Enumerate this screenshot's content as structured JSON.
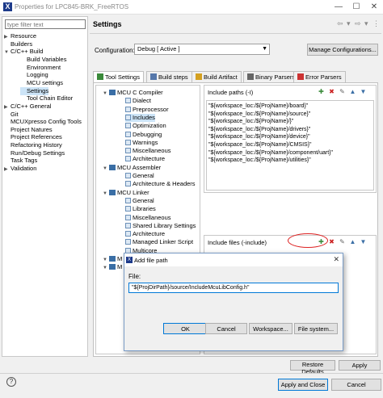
{
  "window": {
    "title": "Properties for LPC845-BRK_FreeRTOS",
    "app_icon_glyph": "X",
    "minimize": "—",
    "maximize": "☐",
    "close": "✕"
  },
  "left": {
    "filter_placeholder": "type filter text",
    "tree": [
      {
        "label": "Resource",
        "arrow": "▶",
        "indent": 0
      },
      {
        "label": "Builders",
        "arrow": "",
        "indent": 0
      },
      {
        "label": "C/C++ Build",
        "arrow": "▼",
        "indent": 0
      },
      {
        "label": "Build Variables",
        "arrow": "",
        "indent": 1
      },
      {
        "label": "Environment",
        "arrow": "",
        "indent": 1
      },
      {
        "label": "Logging",
        "arrow": "",
        "indent": 1
      },
      {
        "label": "MCU settings",
        "arrow": "",
        "indent": 1
      },
      {
        "label": "Settings",
        "arrow": "",
        "indent": 1,
        "selected": true
      },
      {
        "label": "Tool Chain Editor",
        "arrow": "",
        "indent": 1
      },
      {
        "label": "C/C++ General",
        "arrow": "▶",
        "indent": 0
      },
      {
        "label": "Git",
        "arrow": "",
        "indent": 0
      },
      {
        "label": "MCUXpresso Config Tools",
        "arrow": "",
        "indent": 0
      },
      {
        "label": "Project Natures",
        "arrow": "",
        "indent": 0
      },
      {
        "label": "Project References",
        "arrow": "",
        "indent": 0
      },
      {
        "label": "Refactoring History",
        "arrow": "",
        "indent": 0
      },
      {
        "label": "Run/Debug Settings",
        "arrow": "",
        "indent": 0
      },
      {
        "label": "Task Tags",
        "arrow": "",
        "indent": 0
      },
      {
        "label": "Validation",
        "arrow": "▶",
        "indent": 0
      }
    ]
  },
  "header": {
    "title": "Settings",
    "nav": [
      "⇦",
      "▾",
      "⇨",
      "▾",
      "⋮"
    ]
  },
  "config": {
    "label": "Configuration:",
    "value": "Debug  [ Active ]",
    "manage_label": "Manage Configurations..."
  },
  "tabs": [
    {
      "label": "Tool Settings",
      "active": true,
      "color": "#3a8a3a"
    },
    {
      "label": "Build steps",
      "active": false,
      "color": "#5577aa"
    },
    {
      "label": "Build Artifact",
      "active": false,
      "color": "#d4a020"
    },
    {
      "label": "Binary Parsers",
      "active": false,
      "color": "#666666"
    },
    {
      "label": "Error Parsers",
      "active": false,
      "color": "#cc3333"
    }
  ],
  "tooltree": [
    {
      "label": "MCU C Compiler",
      "level": 0,
      "type": "group"
    },
    {
      "label": "Dialect",
      "level": 1
    },
    {
      "label": "Preprocessor",
      "level": 1
    },
    {
      "label": "Includes",
      "level": 1,
      "selected": true
    },
    {
      "label": "Optimization",
      "level": 1
    },
    {
      "label": "Debugging",
      "level": 1
    },
    {
      "label": "Warnings",
      "level": 1
    },
    {
      "label": "Miscellaneous",
      "level": 1
    },
    {
      "label": "Architecture",
      "level": 1
    },
    {
      "label": "MCU Assembler",
      "level": 0,
      "type": "group"
    },
    {
      "label": "General",
      "level": 1
    },
    {
      "label": "Architecture & Headers",
      "level": 1
    },
    {
      "label": "MCU Linker",
      "level": 0,
      "type": "group"
    },
    {
      "label": "General",
      "level": 1
    },
    {
      "label": "Libraries",
      "level": 1
    },
    {
      "label": "Miscellaneous",
      "level": 1
    },
    {
      "label": "Shared Library Settings",
      "level": 1
    },
    {
      "label": "Architecture",
      "level": 1
    },
    {
      "label": "Managed Linker Script",
      "level": 1
    },
    {
      "label": "Multicore",
      "level": 1
    },
    {
      "label": "M",
      "level": 0,
      "type": "group"
    },
    {
      "label": "M",
      "level": 0,
      "type": "group"
    }
  ],
  "include_paths": {
    "label": "Include paths (-I)",
    "items": [
      "\"${workspace_loc:/${ProjName}/board}\"",
      "\"${workspace_loc:/${ProjName}/source}\"",
      "\"${workspace_loc:/${ProjName}/}\"",
      "\"${workspace_loc:/${ProjName}/drivers}\"",
      "\"${workspace_loc:/${ProjName}/device}\"",
      "\"${workspace_loc:/${ProjName}/CMSIS}\"",
      "\"${workspace_loc:/${ProjName}/component/uart}\"",
      "\"${workspace_loc:/${ProjName}/utilities}\""
    ]
  },
  "include_files": {
    "label": "Include files (-include)"
  },
  "dialog": {
    "title": "Add file path",
    "file_label": "File:",
    "file_value": "\"${ProjDirPath}/source/IncludeMcuLibConfig.h\"",
    "ok": "OK",
    "cancel": "Cancel",
    "workspace": "Workspace...",
    "filesystem": "File system...",
    "close": "✕"
  },
  "footer": {
    "restore": "Restore Defaults",
    "apply": "Apply",
    "apply_close": "Apply and Close",
    "cancel": "Cancel",
    "help": "?"
  },
  "colors": {
    "accent": "#0078d7",
    "selection": "#cce4f7",
    "highlight_oval": "#dd2222"
  }
}
